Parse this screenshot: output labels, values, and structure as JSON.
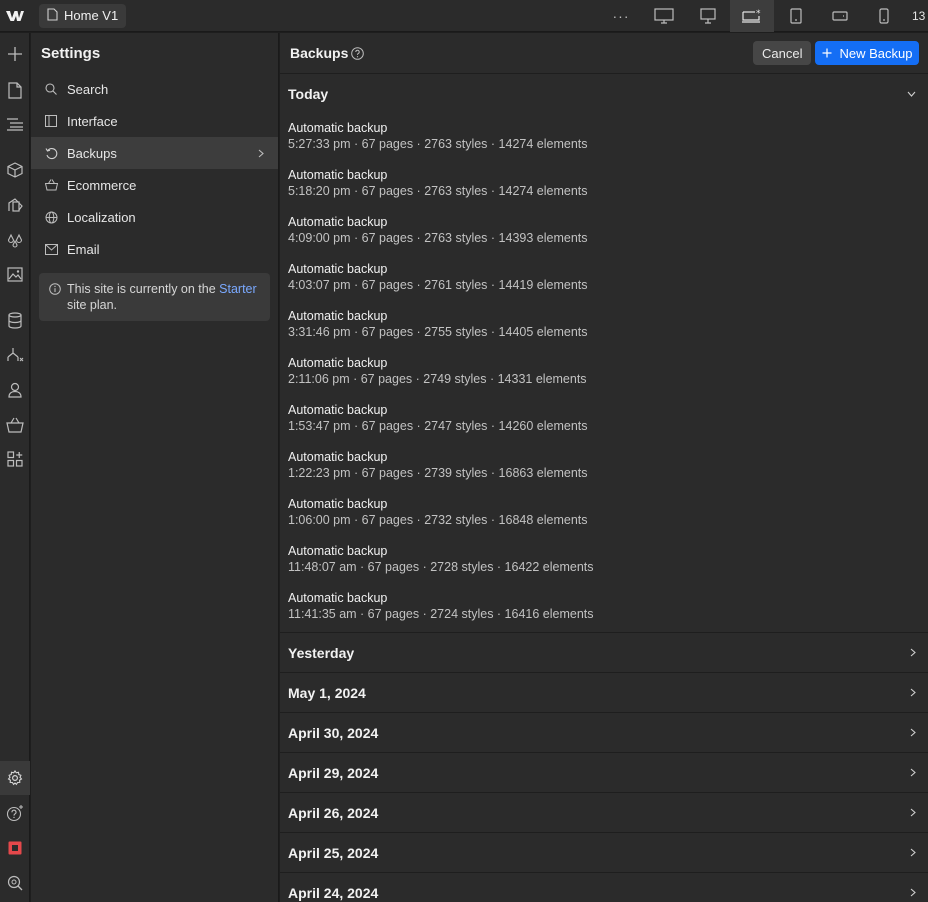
{
  "topbar": {
    "page_name": "Home V1",
    "more_label": "···",
    "breakpoint_value": "13"
  },
  "settings": {
    "title": "Settings",
    "items": [
      {
        "label": "Search",
        "icon": "search-icon"
      },
      {
        "label": "Interface",
        "icon": "layout-icon"
      },
      {
        "label": "Backups",
        "icon": "history-icon"
      },
      {
        "label": "Ecommerce",
        "icon": "basket-icon"
      },
      {
        "label": "Localization",
        "icon": "globe-icon"
      },
      {
        "label": "Email",
        "icon": "mail-icon"
      }
    ],
    "plan_note": {
      "text_before": "This site is currently on the ",
      "link": "Starter",
      "text_after": " site plan."
    }
  },
  "main": {
    "title": "Backups",
    "cancel_label": "Cancel",
    "new_backup_label": "New Backup",
    "today": {
      "label": "Today",
      "backups": [
        {
          "name": "Automatic backup",
          "meta": "5:27:33 pm · 67 pages · 2763 styles · 14274 elements"
        },
        {
          "name": "Automatic backup",
          "meta": "5:18:20 pm · 67 pages · 2763 styles · 14274 elements"
        },
        {
          "name": "Automatic backup",
          "meta": "4:09:00 pm · 67 pages · 2763 styles · 14393 elements"
        },
        {
          "name": "Automatic backup",
          "meta": "4:03:07 pm · 67 pages · 2761 styles · 14419 elements"
        },
        {
          "name": "Automatic backup",
          "meta": "3:31:46 pm · 67 pages · 2755 styles · 14405 elements"
        },
        {
          "name": "Automatic backup",
          "meta": "2:11:06 pm · 67 pages · 2749 styles · 14331 elements"
        },
        {
          "name": "Automatic backup",
          "meta": "1:53:47 pm · 67 pages · 2747 styles · 14260 elements"
        },
        {
          "name": "Automatic backup",
          "meta": "1:22:23 pm · 67 pages · 2739 styles · 16863 elements"
        },
        {
          "name": "Automatic backup",
          "meta": "1:06:00 pm · 67 pages · 2732 styles · 16848 elements"
        },
        {
          "name": "Automatic backup",
          "meta": "11:48:07 am · 67 pages · 2728 styles · 16422 elements"
        },
        {
          "name": "Automatic backup",
          "meta": "11:41:35 am · 67 pages · 2724 styles · 16416 elements"
        }
      ]
    },
    "groups": [
      "Yesterday",
      "May 1, 2024",
      "April 30, 2024",
      "April 29, 2024",
      "April 26, 2024",
      "April 25, 2024",
      "April 24, 2024"
    ]
  },
  "colors": {
    "accent": "#146ef5",
    "link": "#7aa9ff",
    "panel": "#2b2b2b"
  }
}
